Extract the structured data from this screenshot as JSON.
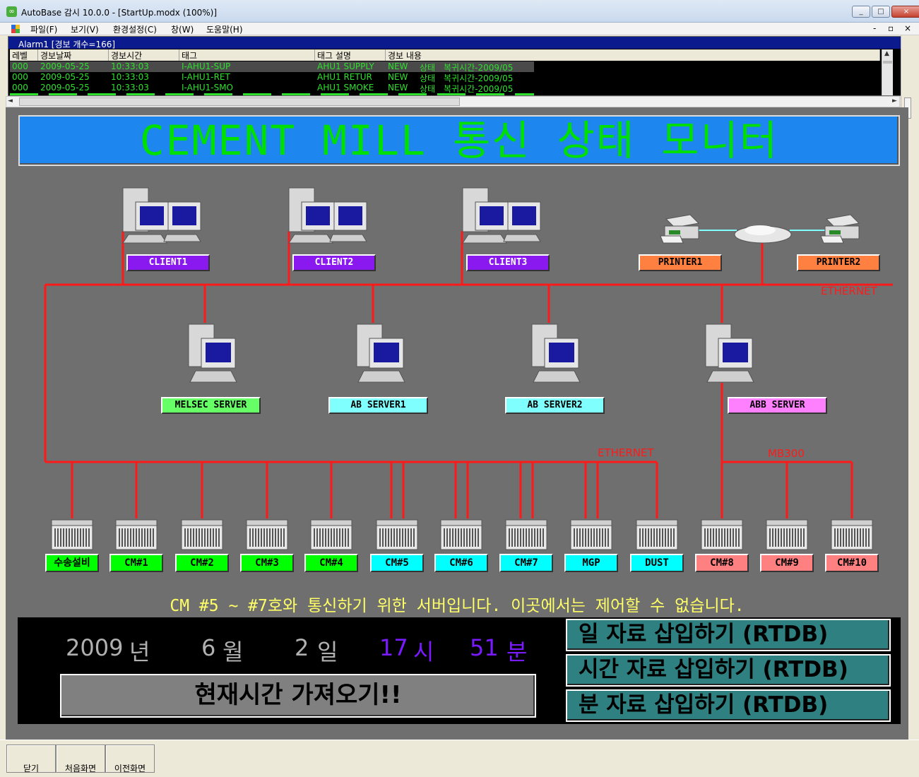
{
  "window": {
    "title": "AutoBase 감시 10.0.0 - [StartUp.modx (100%)]",
    "icon": "autobase-app-icon",
    "controls": [
      "_",
      "□",
      "×"
    ]
  },
  "menu": {
    "items": [
      "파일(F)",
      "보기(V)",
      "환경설정(C)",
      "창(W)",
      "도움말(H)"
    ],
    "mdi_controls": [
      "-",
      "▫",
      "×"
    ]
  },
  "alarm": {
    "title": "Alarm1 [경보 개수=166]",
    "columns": [
      "레벨",
      "경보날짜",
      "경보시간",
      "태그",
      "태그 설명",
      "경보 내용"
    ],
    "rows": [
      [
        "000",
        "2009-05-25",
        "10:33:03",
        "I-AHU1-SUP",
        "AHU1 SUPPLY",
        "NEW",
        "상태",
        "복귀시간-2009/05"
      ],
      [
        "000",
        "2009-05-25",
        "10:33:03",
        "I-AHU1-RET",
        "AHU1 RETUR",
        "NEW",
        "상태",
        "복귀시간-2009/05"
      ],
      [
        "000",
        "2009-05-25",
        "10:33:03",
        "I-AHU1-SMO",
        "AHU1 SMOKE",
        "NEW",
        "상태",
        "복귀시간-2009/05"
      ]
    ]
  },
  "banner": {
    "title": "CEMENT MILL 통신 상태 모니터"
  },
  "clients": [
    "CLIENT1",
    "CLIENT2",
    "CLIENT3"
  ],
  "printers": [
    "PRINTER1",
    "PRINTER2"
  ],
  "servers": [
    "MELSEC SERVER",
    "AB SERVER1",
    "AB SERVER2",
    "ABB SERVER"
  ],
  "network_labels": {
    "top": "ETHERNET",
    "mid": "ETHERNET",
    "mb": "MB300"
  },
  "plcs": [
    "수송설비",
    "CM#1",
    "CM#2",
    "CM#3",
    "CM#4",
    "CM#5",
    "CM#6",
    "CM#7",
    "MGP",
    "DUST",
    "CM#8",
    "CM#9",
    "CM#10"
  ],
  "colors": {
    "client": "#8a19f0",
    "printer": "#ff8040",
    "melsec": "#66ff66",
    "ab": "#80ffff",
    "abb": "#ff80ff",
    "plc_green": "#00ff00",
    "plc_cyan": "#00ffff",
    "plc_red": "#ff8080",
    "wire": "#ff1a1a"
  },
  "notice": "CM #5 ~ #7호와 통신하기 위한 서버입니다. 이곳에서는 제어할 수 없습니다.",
  "datetime": {
    "year": "2009",
    "year_unit": "년",
    "month": "6",
    "month_unit": "월",
    "day": "2",
    "day_unit": "일",
    "hour": "17",
    "hour_unit": "시",
    "minute": "51",
    "minute_unit": "분"
  },
  "buttons": {
    "get_now": "현재시간 가져오기!!",
    "rtdb_day": "일    자료 삽입하기 (RTDB)",
    "rtdb_hour": "시간 자료 삽입하기 (RTDB)",
    "rtdb_min": "분    자료 삽입하기 (RTDB)"
  },
  "bottom": {
    "close": "닫기",
    "first": "처음화면",
    "prev": "이전화면"
  }
}
